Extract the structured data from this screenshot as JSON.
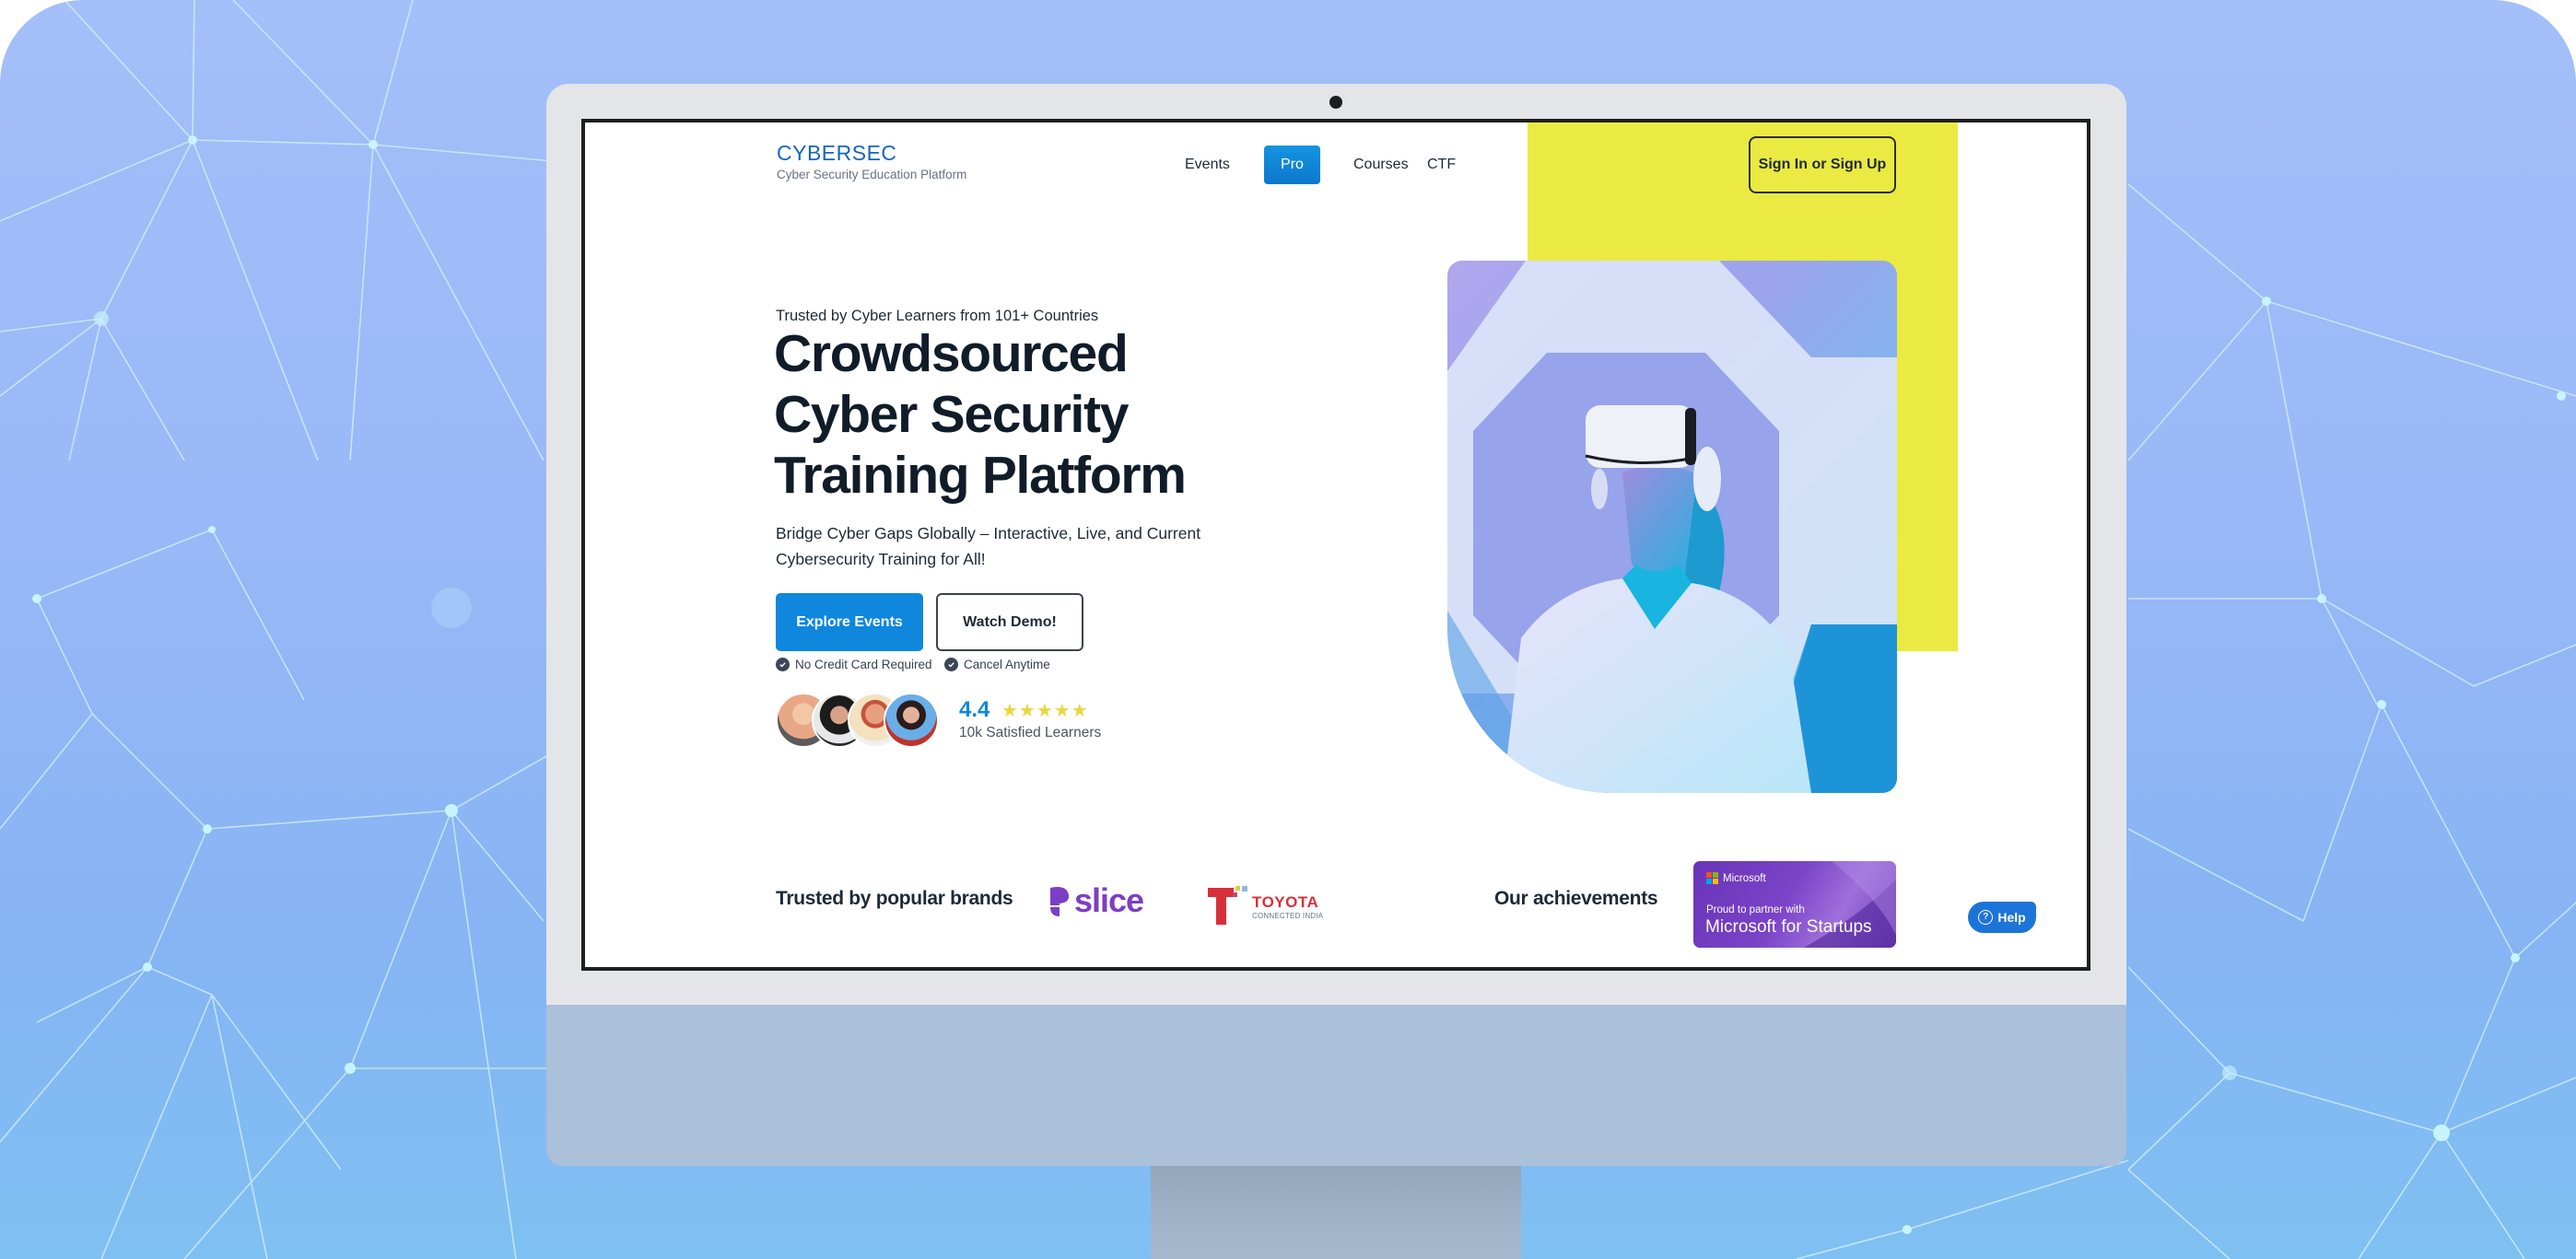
{
  "header": {
    "logo_title": "CYBERSEC",
    "logo_subtitle": "Cyber Security Education Platform",
    "nav": [
      {
        "label": "Events",
        "active": false
      },
      {
        "label": "Pro",
        "active": true
      },
      {
        "label": "Courses",
        "active": false
      },
      {
        "label": "CTF",
        "active": false
      }
    ],
    "signin_label": "Sign In or Sign Up"
  },
  "hero": {
    "eyebrow": "Trusted by Cyber Learners from 101+ Countries",
    "title_lines": [
      "Crowdsourced",
      "Cyber Security",
      "Training Platform"
    ],
    "subtitle": "Bridge Cyber Gaps Globally – Interactive, Live, and Current Cybersecurity Training for All!",
    "primary_cta": "Explore Events",
    "secondary_cta": "Watch Demo!",
    "perks": [
      "No Credit Card Required",
      "Cancel Anytime"
    ],
    "rating": {
      "value": "4.4",
      "stars": "★★★★★",
      "star_count": 5,
      "label": "10k Satisfied Learners"
    },
    "image_alt": "Woman wearing VR headset in front of hexagonal wall"
  },
  "footer_strip": {
    "brands_label": "Trusted by popular brands",
    "brands": [
      {
        "name": "slice",
        "color": "#7c3fc4"
      },
      {
        "name": "TOYOTA",
        "subtitle": "CONNECTED INDIA",
        "color": "#d8303a"
      }
    ],
    "achievements_label": "Our achievements",
    "badge": {
      "brand": "Microsoft",
      "line1": "Proud to partner with",
      "line2": "Microsoft for Startups"
    },
    "help_label": "Help"
  },
  "colors": {
    "primary": "#0f87dc",
    "accent_yellow": "#eaea42",
    "heading": "#111c29",
    "logo_blue": "#1565c0"
  }
}
